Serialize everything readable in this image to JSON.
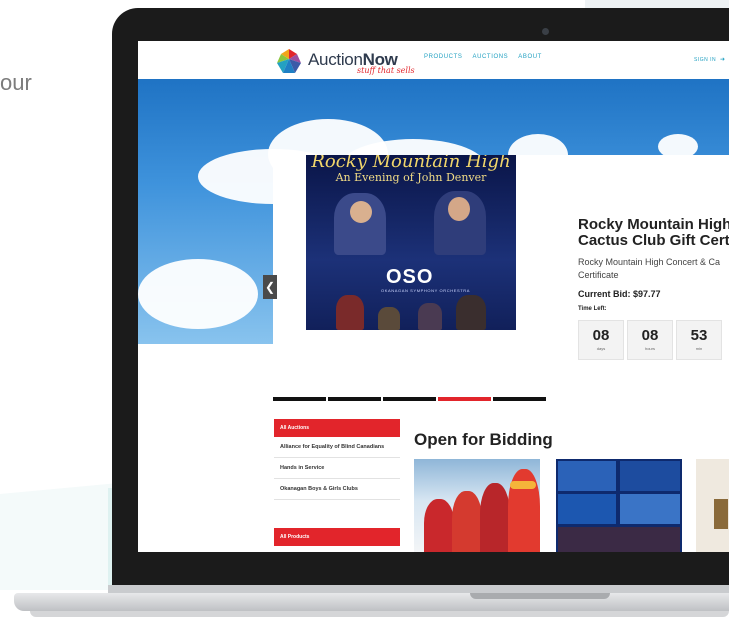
{
  "background": {
    "side_text": "our"
  },
  "site": {
    "brand_prefix": "Auction",
    "brand_bold": "Now",
    "tagline": "stuff that sells",
    "nav": [
      "PRODUCTS",
      "AUCTIONS",
      "ABOUT"
    ],
    "signin": "SIGN IN",
    "colors": {
      "accent": "#e2252b",
      "link": "#23a1c2",
      "sky": "#3f93dc"
    }
  },
  "featured": {
    "poster_title": "Rocky Mountain High",
    "poster_subtitle": "An Evening of John Denver",
    "poster_logo": "OSO",
    "poster_logo_sub": "OKANAGAN SYMPHONY ORCHESTRA",
    "title_line1": "Rocky Mountain High Co",
    "title_line2": "Cactus Club Gift Certifica",
    "description": "Rocky Mountain High Concert & Ca Certificate",
    "current_bid": "Current Bid: $97.77",
    "time_left_label": "Time Left:",
    "time": [
      {
        "value": "08",
        "unit": "days"
      },
      {
        "value": "08",
        "unit": "hours"
      },
      {
        "value": "53",
        "unit": "min"
      }
    ],
    "slides": 5,
    "active_slide": 4,
    "prev_icon": "chevron-left-icon"
  },
  "sidebar": {
    "auctions_header": "All Auctions",
    "auctions": [
      "Alliance for Equality of Blind Canadians",
      "Hands in Service",
      "Okanagan Boys & Girls Clubs"
    ],
    "products_header": "All Products"
  },
  "main": {
    "section_title": "Open for Bidding"
  }
}
